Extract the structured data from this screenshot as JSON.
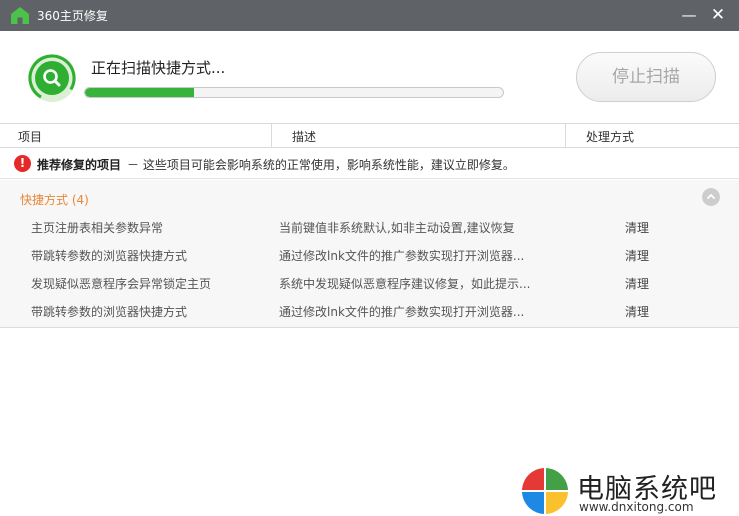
{
  "window": {
    "title": "360主页修复",
    "minimize_glyph": "—",
    "close_glyph": "✕"
  },
  "scan": {
    "status_text": "正在扫描快捷方式...",
    "progress_percent": 26,
    "stop_button_label": "停止扫描"
  },
  "columns": [
    "项目",
    "描述",
    "处理方式"
  ],
  "recommend": {
    "title": "推荐修复的项目",
    "description": "－ 这些项目可能会影响系统的正常使用，影响系统性能，建议立即修复。"
  },
  "group": {
    "title": "快捷方式 (4)",
    "items": [
      {
        "name": "主页注册表相关参数异常",
        "desc": "当前键值非系统默认,如非主动设置,建议恢复",
        "action": "清理"
      },
      {
        "name": "带跳转参数的浏览器快捷方式",
        "desc": "通过修改lnk文件的推广参数实现打开浏览器...",
        "action": "清理"
      },
      {
        "name": "发现疑似恶意程序会异常锁定主页",
        "desc": "系统中发现疑似恶意程序建议修复，如此提示...",
        "action": "清理"
      },
      {
        "name": "带跳转参数的浏览器快捷方式",
        "desc": "通过修改lnk文件的推广参数实现打开浏览器...",
        "action": "清理"
      }
    ]
  },
  "watermark": {
    "title": "电脑系统吧",
    "url": "www.dnxitong.com"
  },
  "colors": {
    "titlebar": "#5f6266",
    "accent_green": "#37b23a",
    "warning_red": "#e52828",
    "group_orange": "#e8873a"
  },
  "icons": {
    "app": "home-icon",
    "scan": "search-icon",
    "warning": "exclamation-icon",
    "collapse": "chevron-up-icon"
  }
}
